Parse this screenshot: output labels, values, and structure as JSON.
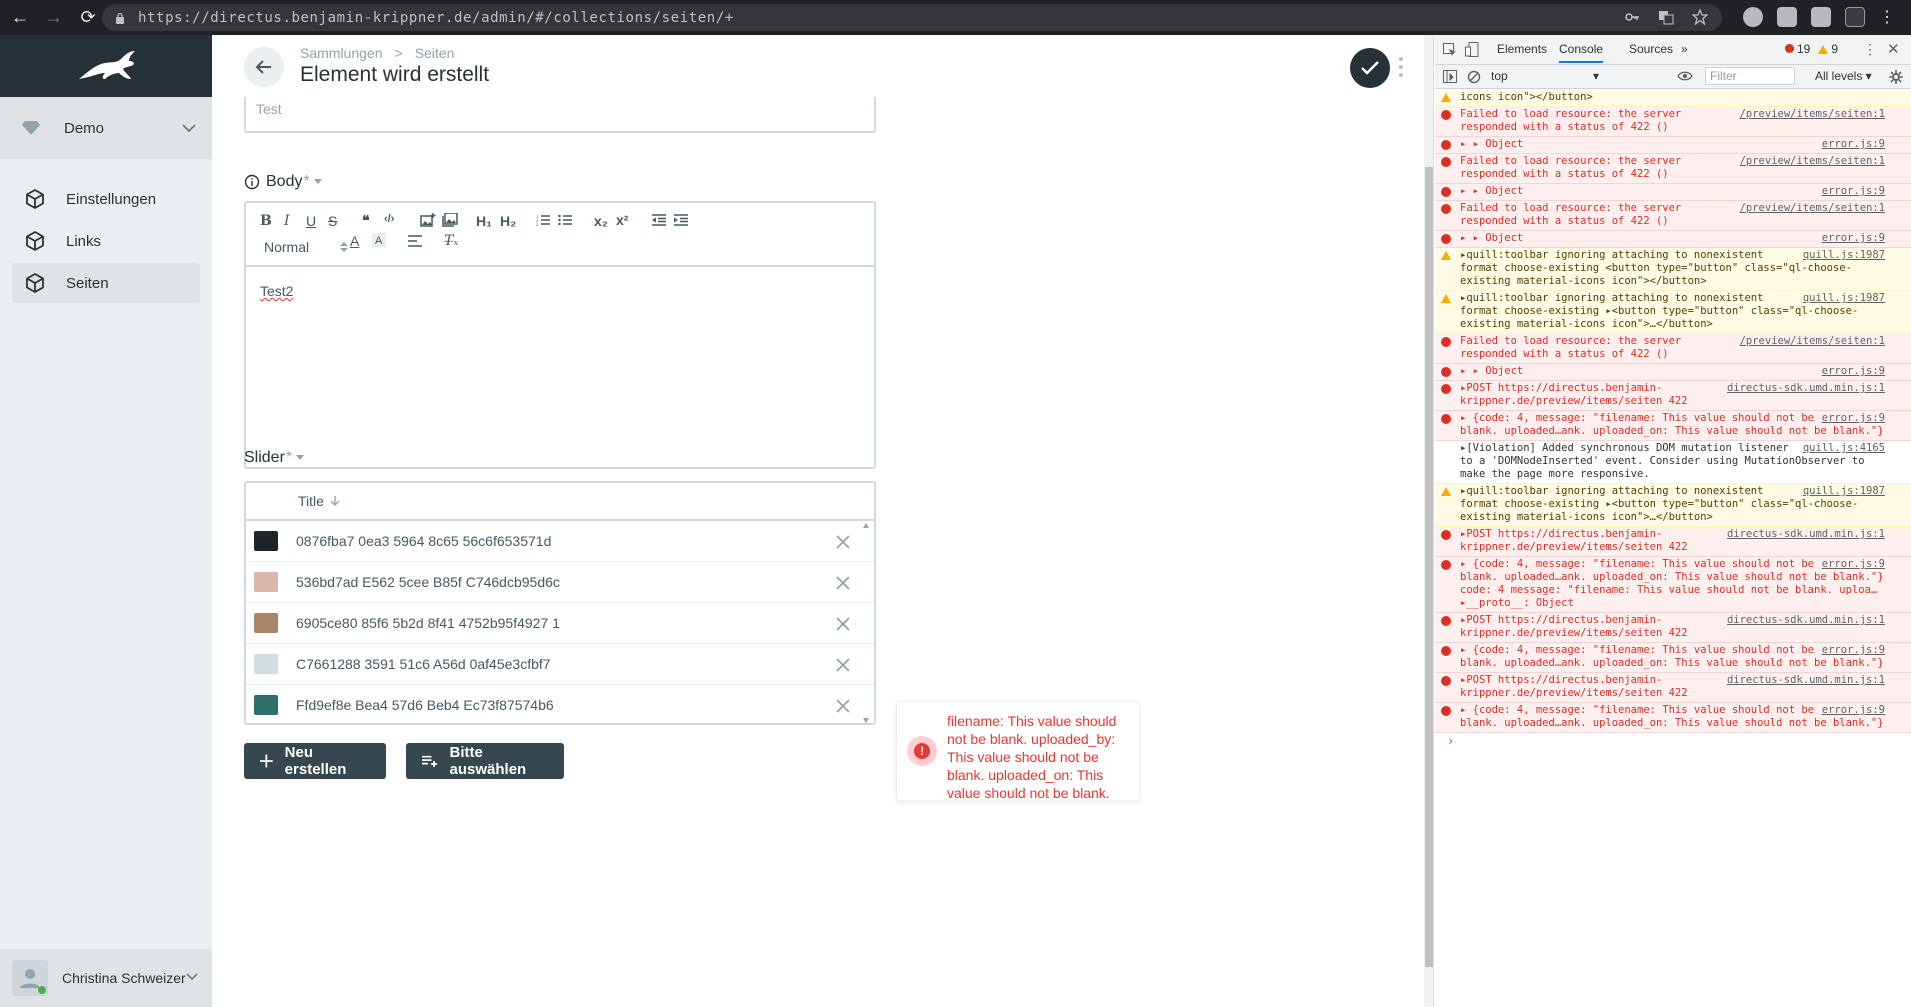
{
  "browser": {
    "url": "https://directus.benjamin-krippner.de/admin/#/collections/seiten/+"
  },
  "sidebar": {
    "project_name": "Demo",
    "items": [
      {
        "label": "Einstellungen"
      },
      {
        "label": "Links"
      },
      {
        "label": "Seiten"
      }
    ],
    "user_name": "Christina Schweizer"
  },
  "header": {
    "breadcrumb": [
      "Sammlungen",
      ">",
      "Seiten"
    ],
    "title": "Element wird erstellt"
  },
  "form": {
    "top_value": "Test",
    "body": {
      "label": "Body",
      "required_mark": "*",
      "toolbar": {
        "bold": "B",
        "italic": "I",
        "underline": "U",
        "strike": "S",
        "quote": "❝",
        "code": "‹/›",
        "h1": "H₁",
        "h2": "H₂",
        "sub": "x₂",
        "sup": "x²",
        "size": "Normal",
        "color": "A",
        "clear": "T̶ₓ"
      },
      "content": "Test2"
    },
    "slider": {
      "label": "Slider",
      "required_mark": "*",
      "column": "Title",
      "rows": [
        {
          "title": "0876fba7 0ea3 5964 8c65 56c6f653571d",
          "thumb": "#1f2428"
        },
        {
          "title": "536bd7ad E562 5cee B85f C746dcb95d6c",
          "thumb": "#d8b8a8"
        },
        {
          "title": "6905ce80 85f6 5b2d 8f41 4752b95f4927 1",
          "thumb": "#a8876a"
        },
        {
          "title": "C7661288 3591 51c6 A56d 0af45e3cfbf7",
          "thumb": "#d0dde3"
        },
        {
          "title": "Ffd9ef8e Bea4 57d6 Beb4 Ec73f87574b6",
          "thumb": "#2f6f6a"
        }
      ]
    },
    "buttons": {
      "new": "Neu erstellen",
      "choose": "Bitte auswählen"
    }
  },
  "toast": {
    "message": "filename: This value should not be blank. uploaded_by: This value should not be blank. uploaded_on: This value should not be blank."
  },
  "devtools": {
    "tabs": [
      "Elements",
      "Console",
      "Sources",
      "»"
    ],
    "active_tab": "Console",
    "error_count": "19",
    "warning_count": "9",
    "context": "top",
    "filter_placeholder": "Filter",
    "levels": "All levels ▾",
    "messages": [
      {
        "level": "warn",
        "text": "icons icon\"></button>",
        "src": ""
      },
      {
        "level": "error",
        "text": "Failed to load resource: the server responded with a status of 422 ()",
        "src": "/preview/items/seiten:1"
      },
      {
        "level": "error",
        "text": "▸ ▸ Object",
        "src": "error.js:9"
      },
      {
        "level": "error",
        "text": "Failed to load resource: the server responded with a status of 422 ()",
        "src": "/preview/items/seiten:1"
      },
      {
        "level": "error",
        "text": "▸ ▸ Object",
        "src": "error.js:9"
      },
      {
        "level": "error",
        "text": "Failed to load resource: the server responded with a status of 422 ()",
        "src": "/preview/items/seiten:1"
      },
      {
        "level": "error",
        "text": "▸ ▸ Object",
        "src": "error.js:9"
      },
      {
        "level": "warn",
        "text": "▸quill:toolbar ignoring attaching to nonexistent format choose-existing <button type=\"button\" class=\"ql-choose-existing material-icons icon\"></button>",
        "src": "quill.js:1987"
      },
      {
        "level": "warn",
        "text": "▸quill:toolbar ignoring attaching to nonexistent format choose-existing ▸<button type=\"button\" class=\"ql-choose-existing material-icons icon\">…</button>",
        "src": "quill.js:1987"
      },
      {
        "level": "error",
        "text": "Failed to load resource: the server responded with a status of 422 ()",
        "src": "/preview/items/seiten:1"
      },
      {
        "level": "error",
        "text": "▸ ▸ Object",
        "src": "error.js:9"
      },
      {
        "level": "error",
        "text": "▸POST https://directus.benjamin-krippner.de/preview/items/seiten 422",
        "src": "directus-sdk.umd.min.js:1"
      },
      {
        "level": "error",
        "text": "▸ {code: 4, message: \"filename: This value should not be blank. uploaded…ank. uploaded_on: This value should not be blank.\"}",
        "src": "error.js:9"
      },
      {
        "level": "info",
        "text": "▸[Violation] Added synchronous DOM mutation listener to a 'DOMNodeInserted' event. Consider using MutationObserver to make the page more responsive.",
        "src": "quill.js:4165"
      },
      {
        "level": "warn",
        "text": "▸quill:toolbar ignoring attaching to nonexistent format choose-existing ▸<button type=\"button\" class=\"ql-choose-existing material-icons icon\">…</button>",
        "src": "quill.js:1987"
      },
      {
        "level": "error",
        "text": "▸POST https://directus.benjamin-krippner.de/preview/items/seiten 422",
        "src": "directus-sdk.umd.min.js:1"
      },
      {
        "level": "error",
        "text": "▸ {code: 4, message: \"filename: This value should not be blank. uploaded…ank. uploaded_on: This value should not be blank.\"} code: 4 message: \"filename: This value should not be blank. uploa… ▸__proto__: Object",
        "src": "error.js:9"
      },
      {
        "level": "error",
        "text": "▸POST https://directus.benjamin-krippner.de/preview/items/seiten 422",
        "src": "directus-sdk.umd.min.js:1"
      },
      {
        "level": "error",
        "text": "▸ {code: 4, message: \"filename: This value should not be blank. uploaded…ank. uploaded_on: This value should not be blank.\"}",
        "src": "error.js:9"
      },
      {
        "level": "error",
        "text": "▸POST https://directus.benjamin-krippner.de/preview/items/seiten 422",
        "src": "directus-sdk.umd.min.js:1"
      },
      {
        "level": "error",
        "text": "▸ {code: 4, message: \"filename: This value should not be blank. uploaded…ank. uploaded_on: This value should not be blank.\"}",
        "src": "error.js:9"
      }
    ],
    "prompt": "›"
  }
}
